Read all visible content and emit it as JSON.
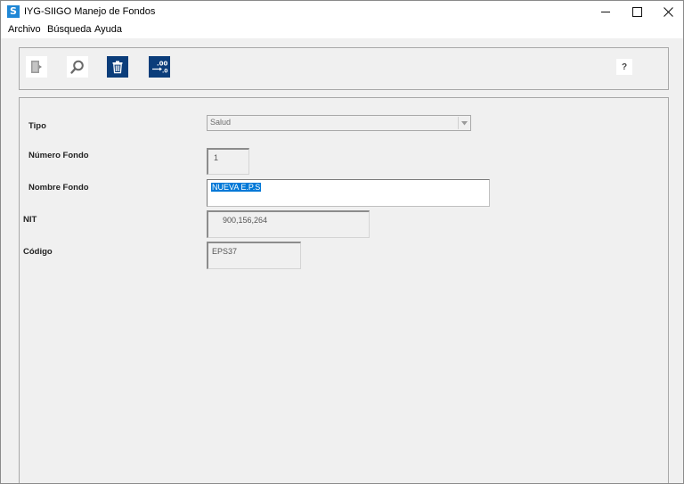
{
  "window": {
    "title": "IYG-SIIGO Manejo de Fondos",
    "app_icon_letter": "S"
  },
  "menu": {
    "items": [
      {
        "label": "Archivo"
      },
      {
        "label": "Búsqueda"
      },
      {
        "label": "Ayuda"
      }
    ]
  },
  "toolbar": {
    "help_label": "?",
    "decimals_label": ".00"
  },
  "form": {
    "tipo": {
      "label": "Tipo",
      "value": "Salud"
    },
    "numero_fondo": {
      "label": "Número Fondo",
      "value": "1"
    },
    "nombre_fondo": {
      "label": "Nombre Fondo",
      "value": "NUEVA E.P.S"
    },
    "nit": {
      "label": "NIT",
      "value": "900,156,264"
    },
    "codigo": {
      "label": "Código",
      "value": "EPS37"
    }
  },
  "colors": {
    "toolbar_dark_button": "#0b3d7a",
    "selection": "#0078d7",
    "app_icon": "#1f87d6"
  }
}
